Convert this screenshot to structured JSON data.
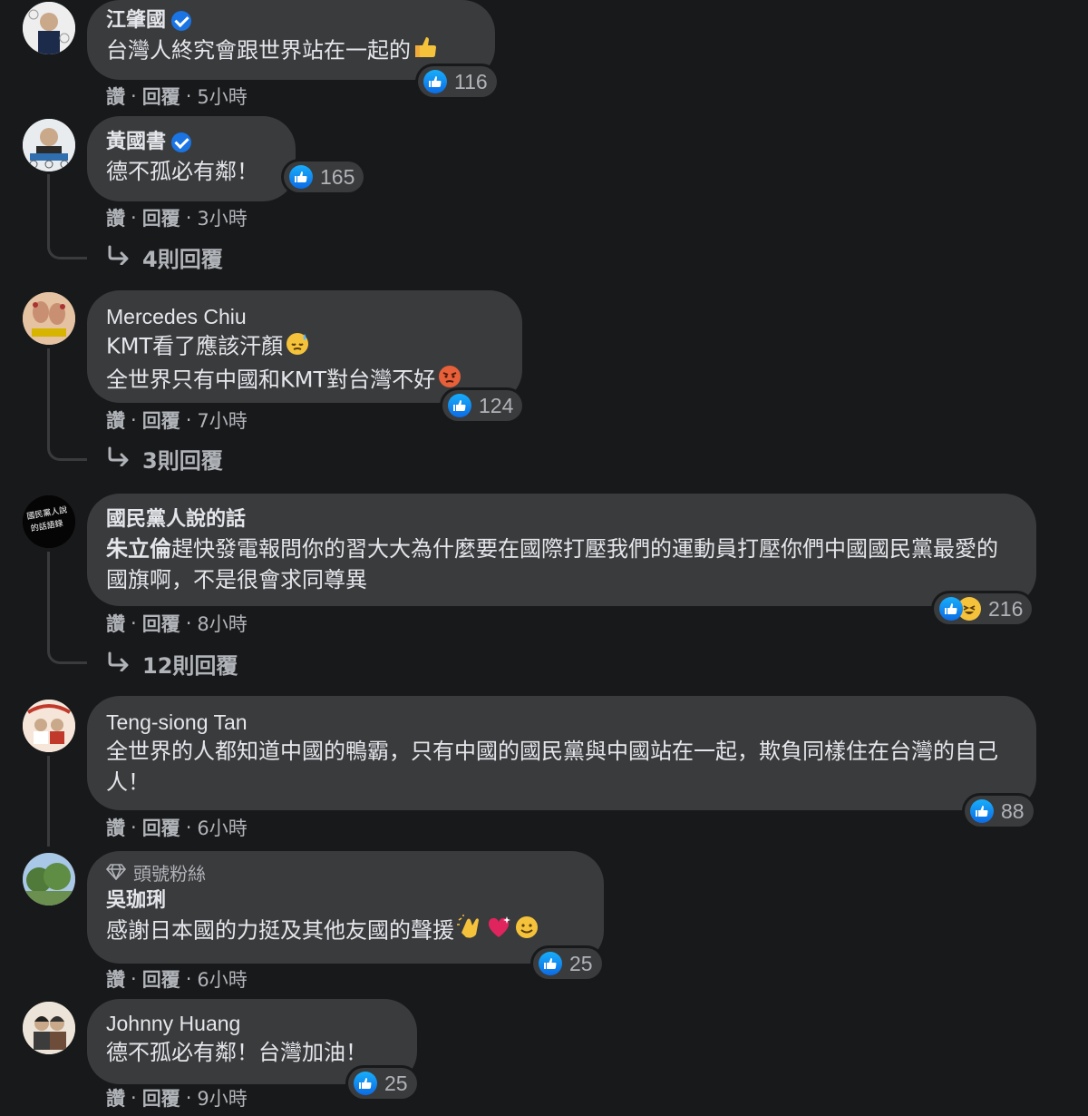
{
  "comments": [
    {
      "name": "江肇國",
      "verified": true,
      "text": "台灣人終究會跟世界站在一起的",
      "emoji": "thumbs-up",
      "actions": {
        "like": "讚",
        "reply": "回覆",
        "time": "5小時"
      },
      "reactions": {
        "types": [
          "like"
        ],
        "count": "116"
      }
    },
    {
      "name": "黃國書",
      "verified": true,
      "text": "德不孤必有鄰！",
      "actions": {
        "like": "讚",
        "reply": "回覆",
        "time": "3小時"
      },
      "reactions": {
        "types": [
          "like"
        ],
        "count": "165"
      },
      "replies": "4則回覆"
    },
    {
      "name": "Mercedes Chiu",
      "line1": "KMT看了應該汗顏",
      "line2": "全世界只有中國和KMT對台灣不好",
      "actions": {
        "like": "讚",
        "reply": "回覆",
        "time": "7小時"
      },
      "reactions": {
        "types": [
          "like"
        ],
        "count": "124"
      },
      "replies": "3則回覆"
    },
    {
      "name": "國民黨人說的話",
      "mention": "朱立倫",
      "text": "趕快發電報問你的習大大為什麼要在國際打壓我們的運動員打壓你們中國國民黨最愛的國旗啊，不是很會求同尊異",
      "actions": {
        "like": "讚",
        "reply": "回覆",
        "time": "8小時"
      },
      "reactions": {
        "types": [
          "like",
          "haha"
        ],
        "count": "216"
      },
      "replies": "12則回覆"
    },
    {
      "name": "Teng-siong Tan",
      "text": "全世界的人都知道中國的鴨霸，只有中國的國民黨與中國站在一起，欺負同樣住在台灣的自己人！",
      "actions": {
        "like": "讚",
        "reply": "回覆",
        "time": "6小時"
      },
      "reactions": {
        "types": [
          "like"
        ],
        "count": "88"
      }
    },
    {
      "badge": "頭號粉絲",
      "name": "吳珈琍",
      "text": "感謝日本國的力挺及其他友國的聲援",
      "actions": {
        "like": "讚",
        "reply": "回覆",
        "time": "6小時"
      },
      "reactions": {
        "types": [
          "like"
        ],
        "count": "25"
      }
    },
    {
      "name": "Johnny Huang",
      "text": "德不孤必有鄰！台灣加油！",
      "actions": {
        "like": "讚",
        "reply": "回覆",
        "time": "9小時"
      },
      "reactions": {
        "types": [
          "like"
        ],
        "count": "25"
      }
    }
  ],
  "colors": {
    "background": "#18191a",
    "bubble": "#3a3b3c",
    "like": "#1b74e4",
    "text": "#e4e6eb",
    "meta": "#b0b3b8"
  }
}
